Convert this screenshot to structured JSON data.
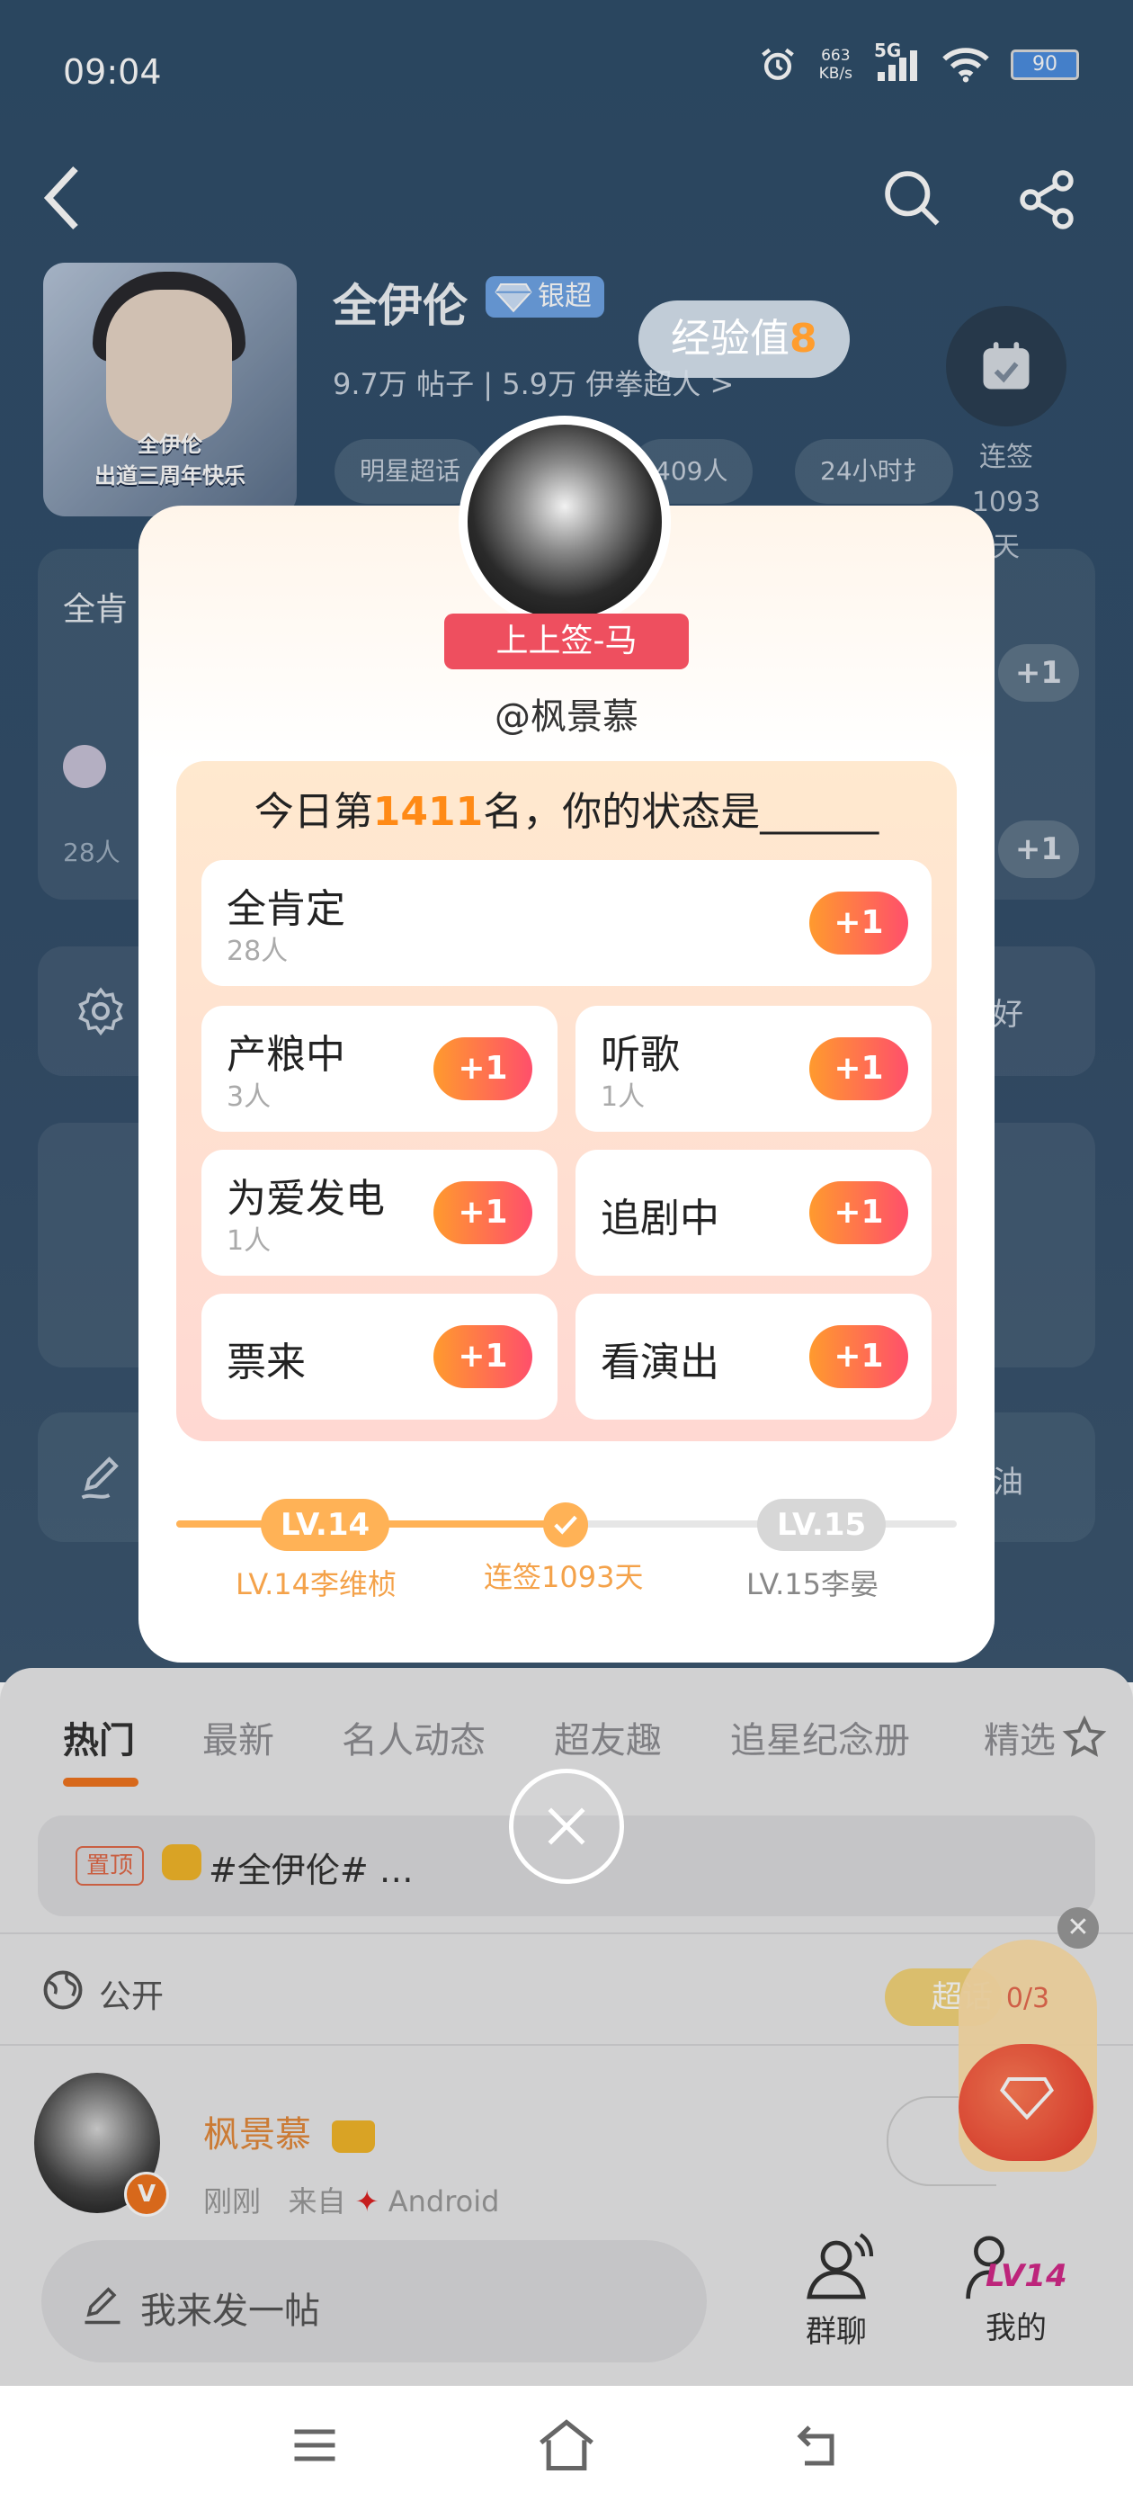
{
  "status_bar": {
    "time": "09:04",
    "net_speed_value": "663",
    "net_speed_unit": "KB/s",
    "network": "5G",
    "battery": "90"
  },
  "header": {
    "title": "全伊伦",
    "badge": "银超",
    "stats": {
      "posts_value": "9.7万",
      "posts_label": "帖子",
      "fans_value": "5.9万",
      "fans_label": "伊拳超人",
      "chevron": ">"
    },
    "pills": [
      "明星超话",
      "409人",
      "24小时扌"
    ],
    "exp_bubble": {
      "label": "经验值",
      "value": "8"
    },
    "checkin": {
      "line1": "连签1093",
      "line2": "天"
    },
    "avatar_caption": {
      "line1": "全伊伦",
      "line2": "出道三周年快乐"
    }
  },
  "background_list": {
    "row1_label": "全肯",
    "row1_count": "28人",
    "plus": "+1",
    "hint1": "好",
    "hint2": "油"
  },
  "popup": {
    "user_tag": "上上签-马",
    "handle": "@枫景慕",
    "question_prefix": "今日第",
    "rank": "1411",
    "question_suffix": "名，你的状态是______",
    "options": [
      {
        "label": "全肯定",
        "count": "28人"
      },
      {
        "label": "产粮中",
        "count": "3人"
      },
      {
        "label": "听歌",
        "count": "1人"
      },
      {
        "label": "为爱发电",
        "count": "1人"
      },
      {
        "label": "追剧中",
        "count": ""
      },
      {
        "label": "票来",
        "count": ""
      },
      {
        "label": "看演出",
        "count": ""
      }
    ],
    "plus_label": "+1",
    "levels": {
      "current": "LV.14",
      "current_name": "LV.14李维桢",
      "middle": "连签1093天",
      "next": "LV.15",
      "next_name": "LV.15李晏"
    },
    "progress_fraction": 0.5
  },
  "tabs": [
    "热门",
    "最新",
    "名人动态",
    "超友趣",
    "追星纪念册",
    "精选"
  ],
  "pinned": {
    "tag": "置顶",
    "text": "#全伊伦# …"
  },
  "public_label": "公开",
  "post": {
    "user": "枫景慕",
    "time": "刚刚",
    "from": "来自",
    "device": "Android"
  },
  "red_packet": {
    "count": "0/3",
    "tag": "超话"
  },
  "bottom_bar": {
    "compose_placeholder": "我来发一帖",
    "group_chat": "群聊",
    "mine": "我的",
    "mine_level": "LV14"
  },
  "colors": {
    "accent_orange": "#ff8a16",
    "plus_gradient_start": "#ff9a2e",
    "plus_gradient_end": "#ff4f6b",
    "ribbon": "#ee4f5f",
    "tab_indicator": "#f0741f"
  }
}
